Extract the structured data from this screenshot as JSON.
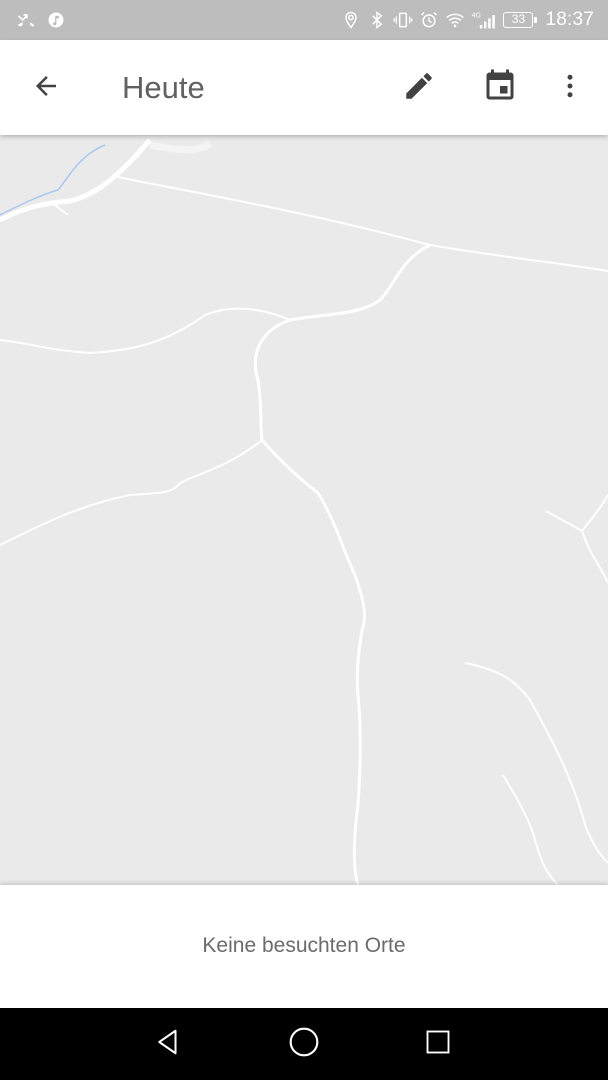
{
  "status_bar": {
    "left_icons": [
      "missed-call-icon",
      "music-icon"
    ],
    "right_icons": [
      "location-icon",
      "bluetooth-icon",
      "vibrate-icon",
      "alarm-icon",
      "wifi-icon",
      "signal-4g-icon"
    ],
    "network_label": "4G",
    "battery_level": "33",
    "time": "18:37"
  },
  "app_bar": {
    "title": "Heute",
    "icons": {
      "back": "arrow-back-icon",
      "edit": "pencil-icon",
      "calendar": "calendar-icon",
      "more": "more-vert-icon"
    }
  },
  "map": {
    "background_color": "#ebeaea",
    "road_color": "#ffffff",
    "water_color": "#a9c8f0"
  },
  "bottom_sheet": {
    "message": "Keine besuchten Orte"
  },
  "nav_bar": {
    "icons": [
      "nav-back-icon",
      "nav-home-icon",
      "nav-recents-icon"
    ]
  }
}
